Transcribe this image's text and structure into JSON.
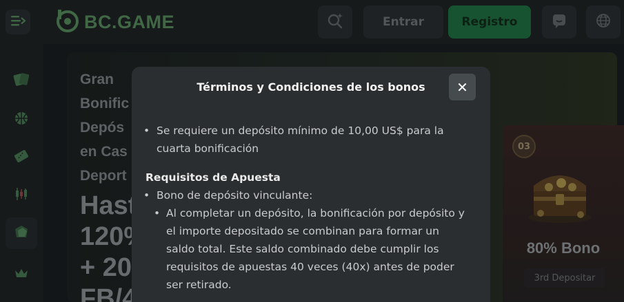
{
  "header": {
    "logo_text": "BC.GAME",
    "login_label": "Entrar",
    "register_label": "Registro"
  },
  "promo": {
    "lines": [
      "Gran",
      "Bonific",
      "Depós",
      "en Cas",
      "Deport"
    ],
    "big_lines": [
      "Hast",
      "120%",
      "+ 20",
      "FB/4"
    ]
  },
  "bonus_card": {
    "number": "03",
    "title": "80% Bono",
    "subtitle": "3rd Depositar"
  },
  "modal": {
    "title": "Términos y Condiciones de los bonos",
    "close_label": "✕",
    "bullet_1": "Se requiere un depósito mínimo de 10,00 US$ para la cuarta bonificación",
    "section_heading": "Requisitos de Apuesta",
    "bullet_2": "Bono de depósito vinculante:",
    "sub_bullet_1": "Al completar un depósito, la bonificación por depósito y el importe depositado se combinan para formar un saldo total. Este saldo combinado debe cumplir los requisitos de apuestas 40 veces (40x) antes de poder ser retirado."
  },
  "colors": {
    "brand_green": "#5f9a63",
    "register_bg": "#1f7a43",
    "modal_bg": "#2a2e30"
  },
  "icons": {
    "menu": "menu-arrow-icon",
    "logo": "bc-logo-icon",
    "search": "search-sparkle-icon",
    "chat": "chat-icon",
    "language": "globe-icon",
    "sidebar": [
      "cards-icon",
      "basketball-icon",
      "ticket-icon",
      "candlestick-icon",
      "bonus-tag-icon",
      "crown-icon"
    ]
  }
}
